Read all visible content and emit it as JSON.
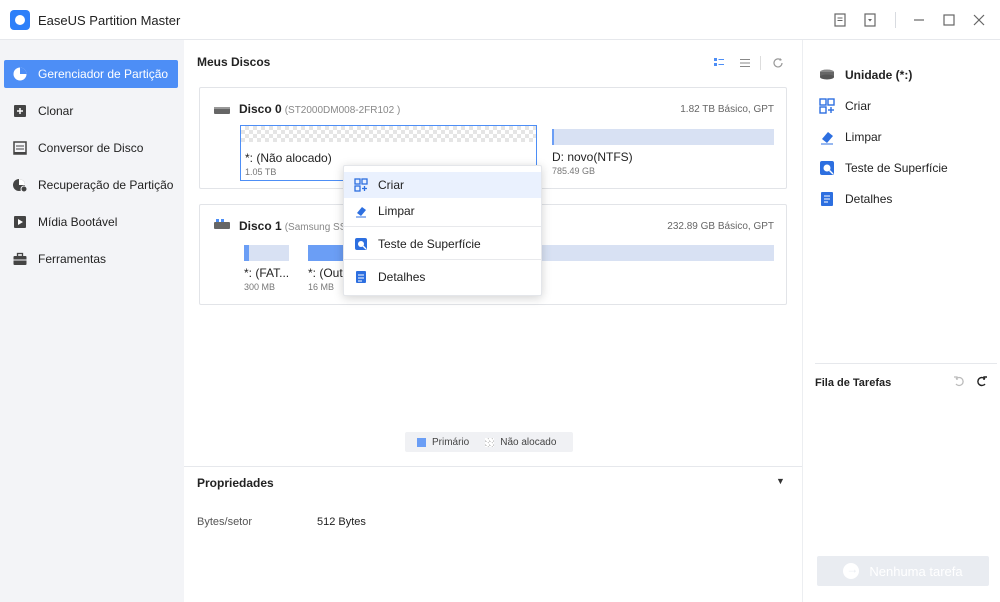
{
  "app": {
    "title": "EaseUS Partition Master"
  },
  "titlebar": {
    "icons": [
      "feedback-icon",
      "dropdown-menu-icon",
      "minimize-icon",
      "maximize-icon",
      "close-icon"
    ]
  },
  "sidebar": {
    "items": [
      {
        "label": "Gerenciador de Partição",
        "icon": "partition-manager-icon",
        "active": true
      },
      {
        "label": "Clonar",
        "icon": "clone-icon"
      },
      {
        "label": "Conversor de Disco",
        "icon": "disk-converter-icon"
      },
      {
        "label": "Recuperação de Partição",
        "icon": "partition-recovery-icon"
      },
      {
        "label": "Mídia Bootável",
        "icon": "bootable-media-icon"
      },
      {
        "label": "Ferramentas",
        "icon": "toolbox-icon"
      }
    ]
  },
  "main": {
    "title": "Meus Discos",
    "disks": [
      {
        "name": "Disco 0",
        "model": "(ST2000DM008-2FR102 )",
        "info": "1.82 TB Básico, GPT",
        "partitions": [
          {
            "label": "*: (Não alocado)",
            "size": "1.05 TB",
            "type": "unallocated",
            "selected": true
          },
          {
            "label": "D: novo(NTFS)",
            "size": "785.49 GB",
            "type": "primary",
            "used_fraction": 0.01
          }
        ]
      },
      {
        "name": "Disco 1",
        "model": "(Samsung SSD",
        "info": "232.89 GB Básico, GPT",
        "partitions": [
          {
            "label": "*: (FAT...",
            "size": "300 MB",
            "type": "primary",
            "used_fraction": 0.1
          },
          {
            "label": "*: (Out...",
            "size": "16 MB",
            "type": "primary",
            "used_fraction": 1.0
          },
          {
            "label": "",
            "size": "",
            "type": "primary",
            "used_fraction": 0.0
          }
        ]
      }
    ],
    "legend": {
      "primary": "Primário",
      "unallocated": "Não alocado"
    },
    "properties": {
      "title": "Propriedades",
      "rows": [
        {
          "key": "Bytes/setor",
          "value": "512 Bytes"
        }
      ]
    }
  },
  "context_menu": {
    "items": [
      {
        "label": "Criar",
        "icon": "create-partition-icon"
      },
      {
        "label": "Limpar",
        "icon": "eraser-icon"
      },
      {
        "label": "Teste de Superfície",
        "icon": "surface-test-icon"
      },
      {
        "label": "Detalhes",
        "icon": "details-icon"
      }
    ]
  },
  "right_panel": {
    "drive": "Unidade (*:)",
    "actions": [
      {
        "label": "Criar",
        "icon": "create-partition-icon"
      },
      {
        "label": "Limpar",
        "icon": "eraser-icon"
      },
      {
        "label": "Teste de Superfície",
        "icon": "surface-test-icon"
      },
      {
        "label": "Detalhes",
        "icon": "details-icon"
      }
    ],
    "queue_title": "Fila de Tarefas",
    "no_task_label": "Nenhuma tarefa"
  },
  "colors": {
    "accent": "#4d8ef6",
    "primary_partition": "#6b9ef5",
    "sidebar_bg": "#f3f4f7"
  }
}
